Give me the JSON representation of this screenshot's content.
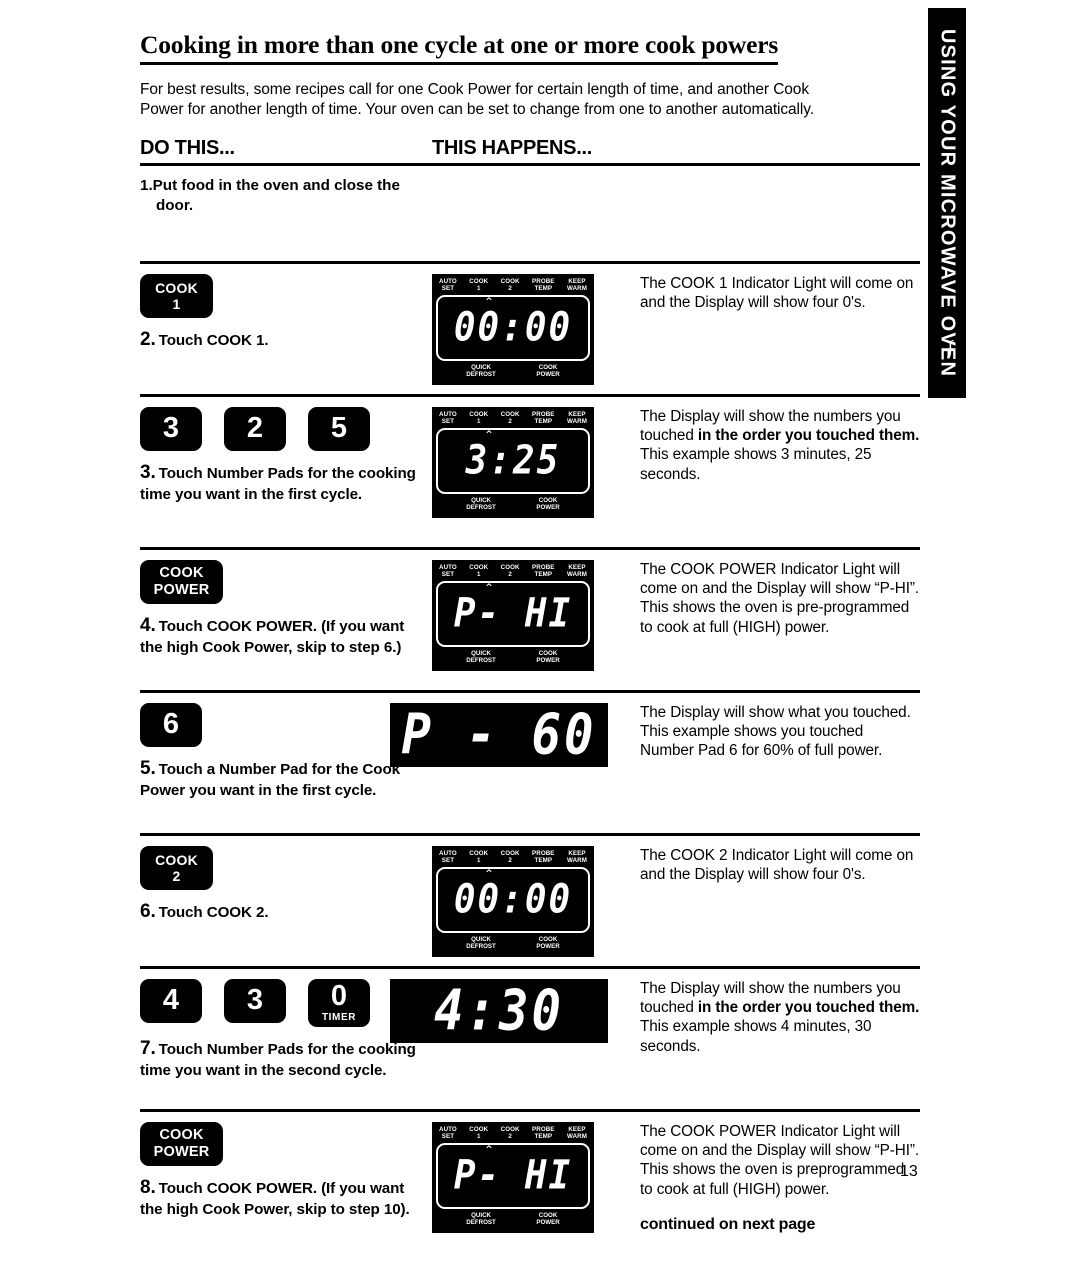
{
  "side_tab": {
    "label": "USING YOUR MICROWAVE OVEN",
    "curl": "∫"
  },
  "title": "Cooking in more than one cycle at one or more cook powers",
  "intro": "For best results, some recipes call for one Cook Power for certain length of time, and another Cook Power for another length of time. Your oven can be set to change from one to another automatically.",
  "columns": {
    "do_this": "DO THIS...",
    "this_happens": "THIS HAPPENS..."
  },
  "panel_labels": {
    "top": [
      "AUTO\nSET",
      "COOK\n1",
      "COOK\n2",
      "PROBE\nTEMP",
      "KEEP\nWARM"
    ],
    "bottom": [
      "QUICK\nDEFROST",
      "COOK\nPOWER"
    ]
  },
  "steps": [
    {
      "number": "1.",
      "instruction": "Put food in the oven and close the door.",
      "pads": [],
      "display": null,
      "result": ""
    },
    {
      "number": "2.",
      "instruction": "Touch COOK 1.",
      "pads": [
        {
          "type": "word",
          "line1": "COOK",
          "line2": "1"
        }
      ],
      "display": {
        "kind": "panel",
        "value": "00:00"
      },
      "result_html": "The COOK 1 Indicator Light will come on and the Display will show four 0's."
    },
    {
      "number": "3.",
      "instruction": "Touch Number Pads for the cooking time you want in the first cycle.",
      "pads": [
        {
          "type": "num",
          "value": "3"
        },
        {
          "type": "num",
          "value": "2"
        },
        {
          "type": "num",
          "value": "5"
        }
      ],
      "display": {
        "kind": "panel",
        "value": "3:25"
      },
      "result_html": "The Display will show the numbers you touched <b>in the order you touched them.</b> This example shows 3 minutes, 25 seconds."
    },
    {
      "number": "4.",
      "instruction": "Touch COOK POWER. (If you want the high Cook Power, skip to step 6.)",
      "pads": [
        {
          "type": "word",
          "line1": "COOK",
          "line2": "POWER"
        }
      ],
      "display": {
        "kind": "panel",
        "value": "P- HI"
      },
      "result_html": "The COOK POWER Indicator Light will come on and the Display will show “P-HI”. This shows the oven is pre-programmed to cook at full (HIGH) power."
    },
    {
      "number": "5.",
      "instruction": "Touch a Number Pad for the Cook Power you want in the first cycle.",
      "pads": [
        {
          "type": "num",
          "value": "6"
        }
      ],
      "display": {
        "kind": "big",
        "value": "P - 60"
      },
      "result_html": "The Display will show what you touched. This example shows you touched Number Pad 6 for 60% of full power."
    },
    {
      "number": "6.",
      "instruction": "Touch COOK 2.",
      "pads": [
        {
          "type": "word",
          "line1": "COOK",
          "line2": "2"
        }
      ],
      "display": {
        "kind": "panel",
        "value": "00:00"
      },
      "result_html": "The COOK 2 Indicator Light will come on and the Display will show four 0's."
    },
    {
      "number": "7.",
      "instruction": "Touch Number Pads for the cooking time you want in the second cycle.",
      "pads": [
        {
          "type": "num",
          "value": "4"
        },
        {
          "type": "num",
          "value": "3"
        },
        {
          "type": "num",
          "value": "0",
          "sub": "TIMER"
        }
      ],
      "display": {
        "kind": "big",
        "value": "4:30"
      },
      "result_html": "The Display will show the numbers you touched <b>in the order you touched them.</b> This example shows 4 minutes, 30 seconds."
    },
    {
      "number": "8.",
      "instruction": "Touch COOK POWER. (If you want the high Cook Power, skip to step 10).",
      "pads": [
        {
          "type": "word",
          "line1": "COOK",
          "line2": "POWER"
        }
      ],
      "display": {
        "kind": "panel",
        "value": "P- HI"
      },
      "result_html": "The COOK POWER Indicator Light will come on and the Display will show “P-HI”. This shows the oven is preprogrammed to cook at full (HIGH) power."
    }
  ],
  "footer": {
    "continued": "continued on next page",
    "page_number": "13"
  }
}
